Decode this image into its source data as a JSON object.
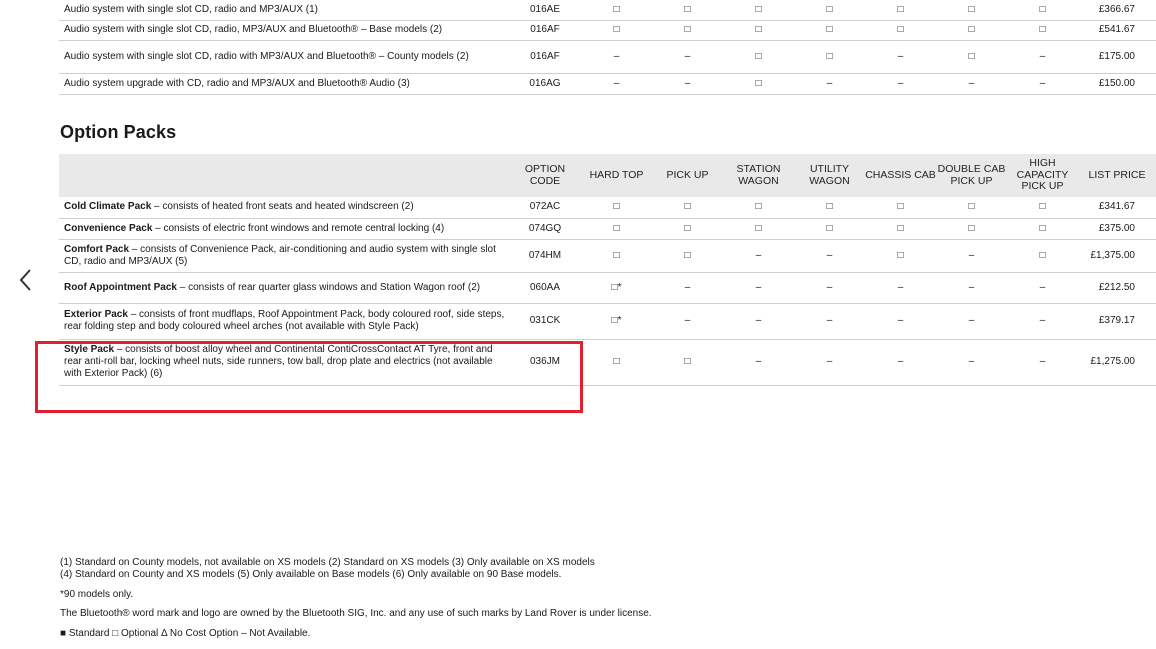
{
  "audio_rows": [
    {
      "desc": "Audio system with single slot CD, radio and MP3/AUX (1)",
      "code": "016AE",
      "vals": [
        "□",
        "□",
        "□",
        "□",
        "□",
        "□",
        "□"
      ],
      "price": "£366.67"
    },
    {
      "desc": "Audio system with single slot CD, radio, MP3/AUX and Bluetooth® – Base models (2)",
      "code": "016AF",
      "vals": [
        "□",
        "□",
        "□",
        "□",
        "□",
        "□",
        "□"
      ],
      "price": "£541.67"
    },
    {
      "desc": "Audio system with single slot CD, radio with MP3/AUX and Bluetooth® – County models (2)",
      "code": "016AF",
      "vals": [
        "–",
        "–",
        "□",
        "□",
        "–",
        "□",
        "–"
      ],
      "price": "£175.00"
    },
    {
      "desc": "Audio system upgrade with CD, radio and MP3/AUX and Bluetooth® Audio (3)",
      "code": "016AG",
      "vals": [
        "–",
        "–",
        "□",
        "–",
        "–",
        "–",
        "–"
      ],
      "price": "£150.00"
    }
  ],
  "section_title": "Option Packs",
  "headers": {
    "option_code": "OPTION CODE",
    "hard_top": "HARD TOP",
    "pick_up": "PICK UP",
    "station_wagon": "STATION WAGON",
    "utility_wagon": "UTILITY WAGON",
    "chassis_cab": "CHASSIS CAB",
    "double_cab": "DOUBLE CAB PICK UP",
    "high_capacity": "HIGH CAPACITY PICK UP",
    "list_price": "LIST PRICE"
  },
  "packs": [
    {
      "name": "Cold Climate Pack",
      "desc": " – consists of heated front seats and heated windscreen (2)",
      "code": "072AC",
      "vals": [
        "□",
        "□",
        "□",
        "□",
        "□",
        "□",
        "□"
      ],
      "price": "£341.67"
    },
    {
      "name": "Convenience Pack",
      "desc": " – consists of electric front windows and remote central locking (4)",
      "code": "074GQ",
      "vals": [
        "□",
        "□",
        "□",
        "□",
        "□",
        "□",
        "□"
      ],
      "price": "£375.00"
    },
    {
      "name": "Comfort Pack",
      "desc": " – consists of Convenience Pack, air-conditioning and audio system with single slot CD, radio and MP3/AUX (5)",
      "code": "074HM",
      "vals": [
        "□",
        "□",
        "–",
        "–",
        "□",
        "–",
        "□"
      ],
      "price": "£1,375.00"
    },
    {
      "name": "Roof Appointment Pack",
      "desc": " – consists of rear quarter glass windows and Station Wagon roof (2)",
      "code": "060AA",
      "vals": [
        "□*",
        "–",
        "–",
        "–",
        "–",
        "–",
        "–"
      ],
      "price": "£212.50"
    },
    {
      "name": "Exterior Pack",
      "desc": " – consists of front mudflaps, Roof Appointment Pack, body coloured roof, side steps, rear folding step and body coloured wheel arches (not available with Style Pack)",
      "code": "031CK",
      "vals": [
        "□*",
        "–",
        "–",
        "–",
        "–",
        "–",
        "–"
      ],
      "price": "£379.17"
    },
    {
      "name": "Style Pack",
      "desc": " – consists of boost alloy wheel and Continental ContiCrossContact AT Tyre, front and rear anti-roll bar, locking wheel nuts, side runners, tow ball, drop plate and electrics (not available with Exterior Pack) (6)",
      "code": "036JM",
      "vals": [
        "□",
        "□",
        "–",
        "–",
        "–",
        "–",
        "–"
      ],
      "price": "£1,275.00"
    }
  ],
  "footnotes": {
    "line1": "(1) Standard on County models, not available on XS models   (2) Standard on XS models   (3) Only available on XS models",
    "line2": "(4) Standard on County and XS models   (5) Only available on Base models   (6) Only available on 90 Base models.",
    "line3": "*90 models only.",
    "line4": "The Bluetooth® word mark and logo are owned by the Bluetooth SIG, Inc. and any use of such marks by Land Rover is under license.",
    "legend": "■ Standard   □ Optional   Δ No Cost Option   – Not Available."
  },
  "colors": {
    "highlight": "#e0202f",
    "header_bg": "#e9e9e9"
  },
  "icons": {
    "nav": "chevron-left-icon"
  }
}
